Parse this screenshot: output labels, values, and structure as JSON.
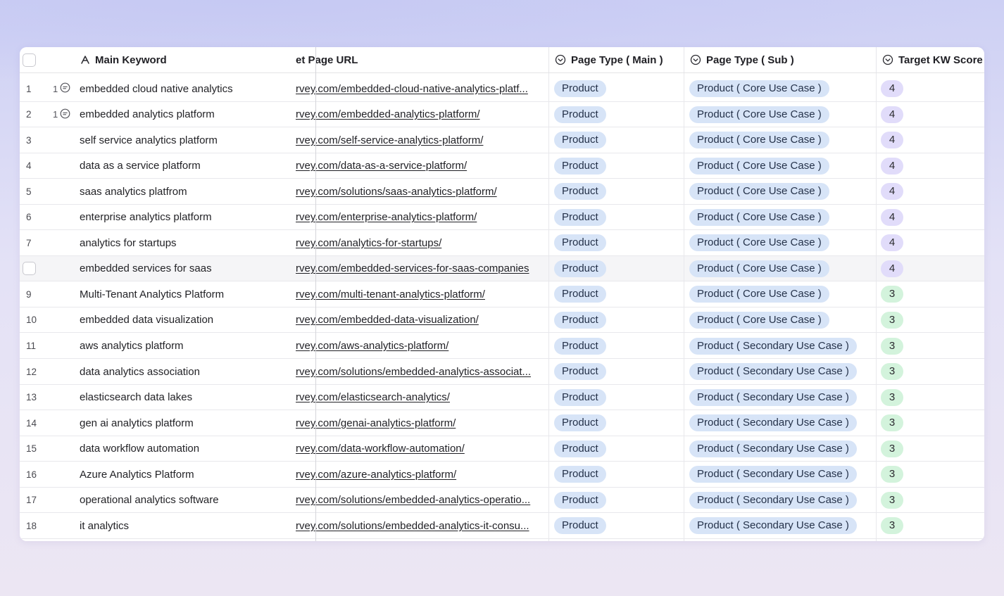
{
  "columns": {
    "main_keyword": "Main Keyword",
    "page_url": "et Page URL",
    "page_type_main": "Page Type ( Main )",
    "page_type_sub": "Page Type ( Sub )",
    "target_kw_score": "Target KW Score"
  },
  "colors": {
    "pill_blue": "#d7e4f7",
    "score_purple": "#e1dcfa",
    "score_green": "#d3f3dc"
  },
  "rows": [
    {
      "num": "1",
      "comments": "1",
      "keyword": "embedded cloud native analytics",
      "url": "rvey.com/embedded-cloud-native-analytics-platf...",
      "main": "Product",
      "sub": "Product ( Core Use Case )",
      "score": "4",
      "score_color": "purple"
    },
    {
      "num": "2",
      "comments": "1",
      "keyword": "embedded analytics platform",
      "url": "rvey.com/embedded-analytics-platform/",
      "main": "Product",
      "sub": "Product ( Core Use Case )",
      "score": "4",
      "score_color": "purple"
    },
    {
      "num": "3",
      "comments": "",
      "keyword": "self service analytics platform",
      "url": "rvey.com/self-service-analytics-platform/",
      "main": "Product",
      "sub": "Product ( Core Use Case )",
      "score": "4",
      "score_color": "purple"
    },
    {
      "num": "4",
      "comments": "",
      "keyword": "data as a service platform",
      "url": "rvey.com/data-as-a-service-platform/",
      "main": "Product",
      "sub": "Product ( Core Use Case )",
      "score": "4",
      "score_color": "purple"
    },
    {
      "num": "5",
      "comments": "",
      "keyword": "saas analytics platfrom",
      "url": "rvey.com/solutions/saas-analytics-platform/",
      "main": "Product",
      "sub": "Product ( Core Use Case )",
      "score": "4",
      "score_color": "purple"
    },
    {
      "num": "6",
      "comments": "",
      "keyword": "enterprise analytics platform",
      "url": "rvey.com/enterprise-analytics-platform/",
      "main": "Product",
      "sub": "Product ( Core Use Case )",
      "score": "4",
      "score_color": "purple"
    },
    {
      "num": "7",
      "comments": "",
      "keyword": "analytics for startups",
      "url": "rvey.com/analytics-for-startups/",
      "main": "Product",
      "sub": "Product ( Core Use Case )",
      "score": "4",
      "score_color": "purple"
    },
    {
      "num": "",
      "comments": "",
      "keyword": "embedded services for saas",
      "url": "rvey.com/embedded-services-for-saas-companies",
      "main": "Product",
      "sub": "Product ( Core Use Case )",
      "score": "4",
      "score_color": "purple",
      "hover": true
    },
    {
      "num": "9",
      "comments": "",
      "keyword": "Multi-Tenant Analytics Platform",
      "url": "rvey.com/multi-tenant-analytics-platform/",
      "main": "Product",
      "sub": "Product ( Core Use Case )",
      "score": "3",
      "score_color": "green"
    },
    {
      "num": "10",
      "comments": "",
      "keyword": "embedded data visualization",
      "url": "rvey.com/embedded-data-visualization/",
      "main": "Product",
      "sub": "Product ( Core Use Case )",
      "score": "3",
      "score_color": "green"
    },
    {
      "num": "11",
      "comments": "",
      "keyword": "aws analytics platform",
      "url": "rvey.com/aws-analytics-platform/",
      "main": "Product",
      "sub": "Product ( Secondary Use Case )",
      "score": "3",
      "score_color": "green"
    },
    {
      "num": "12",
      "comments": "",
      "keyword": "data analytics association",
      "url": "rvey.com/solutions/embedded-analytics-associat...",
      "main": "Product",
      "sub": "Product ( Secondary Use Case )",
      "score": "3",
      "score_color": "green"
    },
    {
      "num": "13",
      "comments": "",
      "keyword": "elasticsearch data lakes",
      "url": "rvey.com/elasticsearch-analytics/",
      "main": "Product",
      "sub": "Product ( Secondary Use Case )",
      "score": "3",
      "score_color": "green"
    },
    {
      "num": "14",
      "comments": "",
      "keyword": "gen ai analytics platform",
      "url": "rvey.com/genai-analytics-platform/",
      "main": "Product",
      "sub": "Product ( Secondary Use Case )",
      "score": "3",
      "score_color": "green"
    },
    {
      "num": "15",
      "comments": "",
      "keyword": "data workflow automation",
      "url": "rvey.com/data-workflow-automation/",
      "main": "Product",
      "sub": "Product ( Secondary Use Case )",
      "score": "3",
      "score_color": "green"
    },
    {
      "num": "16",
      "comments": "",
      "keyword": "Azure Analytics Platform",
      "url": "rvey.com/azure-analytics-platform/",
      "main": "Product",
      "sub": "Product ( Secondary Use Case )",
      "score": "3",
      "score_color": "green"
    },
    {
      "num": "17",
      "comments": "",
      "keyword": "operational analytics software",
      "url": "rvey.com/solutions/embedded-analytics-operatio...",
      "main": "Product",
      "sub": "Product ( Secondary Use Case )",
      "score": "3",
      "score_color": "green"
    },
    {
      "num": "18",
      "comments": "",
      "keyword": "it analytics",
      "url": "rvey.com/solutions/embedded-analytics-it-consu...",
      "main": "Product",
      "sub": "Product ( Secondary Use Case )",
      "score": "3",
      "score_color": "green"
    }
  ]
}
